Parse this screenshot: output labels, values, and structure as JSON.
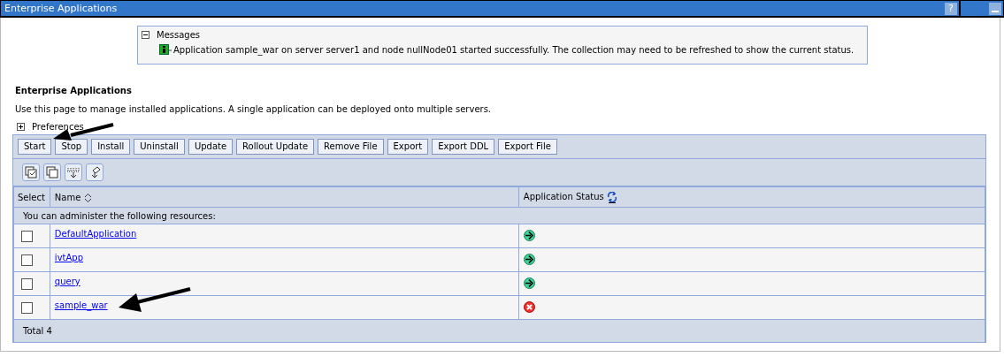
{
  "window": {
    "title": "Enterprise Applications",
    "help": "?"
  },
  "messages": {
    "title": "Messages",
    "expanded": true,
    "items": [
      {
        "kind": "info",
        "text": "Application sample_war on server server1 and node nullNode01 started successfully. The collection may need to be refreshed to show the current status."
      }
    ]
  },
  "heading": "Enterprise Applications",
  "description": "Use this page to manage installed applications. A single application can be deployed onto multiple servers.",
  "preferences": {
    "label": "Preferences",
    "expanded": false
  },
  "buttons": [
    "Start",
    "Stop",
    "Install",
    "Uninstall",
    "Update",
    "Rollout Update",
    "Remove File",
    "Export",
    "Export DDL",
    "Export File"
  ],
  "table": {
    "columns": [
      "Select",
      "Name",
      "Application Status"
    ],
    "info": "You can administer the following resources:",
    "rows": [
      {
        "name": "DefaultApplication",
        "checked": false,
        "running": true
      },
      {
        "name": "ivtApp",
        "checked": false,
        "running": true
      },
      {
        "name": "query",
        "checked": false,
        "running": true
      },
      {
        "name": "sample_war",
        "checked": false,
        "running": false
      }
    ],
    "total": "Total 4"
  }
}
